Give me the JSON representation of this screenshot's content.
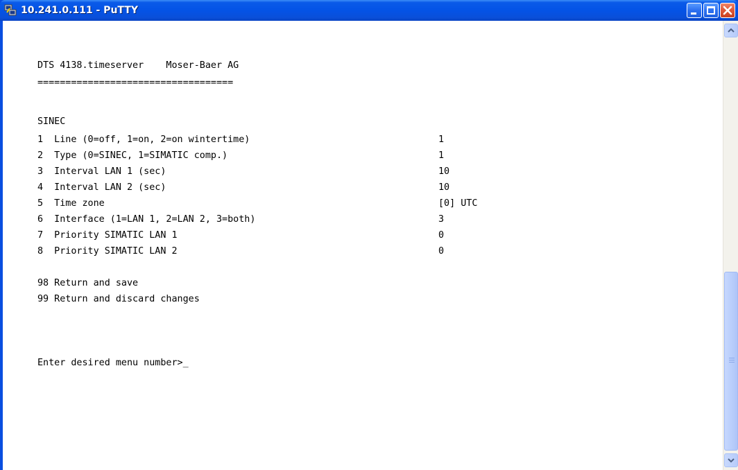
{
  "window": {
    "title": "10.241.0.111 - PuTTY"
  },
  "colors": {
    "titlebar": "#0453e6",
    "terminal_bg": "#ffffff",
    "terminal_fg": "#000000",
    "close_button": "#e05a3a"
  },
  "icons": {
    "app": "putty-icon",
    "minimize": "minimize-icon",
    "maximize": "maximize-icon",
    "close": "close-icon",
    "scroll_up": "chevron-up-icon",
    "scroll_down": "chevron-down-icon"
  },
  "terminal": {
    "header": "DTS 4138.timeserver    Moser-Baer AG",
    "separator": "===================================",
    "section_title": "SINEC",
    "menu_items": [
      {
        "label": "1  Line (0=off, 1=on, 2=on wintertime)",
        "value": "1"
      },
      {
        "label": "2  Type (0=SINEC, 1=SIMATIC comp.)",
        "value": "1"
      },
      {
        "label": "3  Interval LAN 1 (sec)",
        "value": "10"
      },
      {
        "label": "4  Interval LAN 2 (sec)",
        "value": "10"
      },
      {
        "label": "5  Time zone",
        "value": "[0] UTC"
      },
      {
        "label": "6  Interface (1=LAN 1, 2=LAN 2, 3=both)",
        "value": "3"
      },
      {
        "label": "7  Priority SIMATIC LAN 1",
        "value": "0"
      },
      {
        "label": "8  Priority SIMATIC LAN 2",
        "value": "0"
      }
    ],
    "return_save": "98 Return and save",
    "return_discard": "99 Return and discard changes",
    "prompt": "Enter desired menu number>",
    "cursor": "_"
  }
}
